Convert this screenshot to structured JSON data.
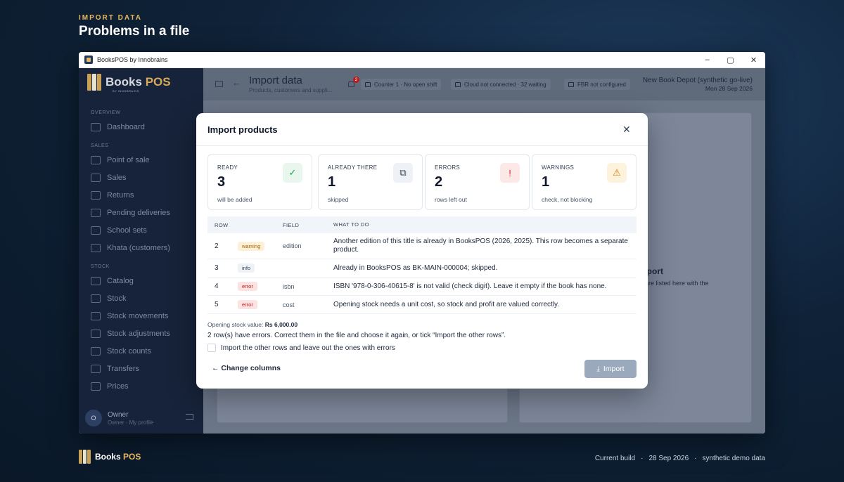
{
  "hero": {
    "eyebrow": "IMPORT DATA",
    "title": "Problems in a file"
  },
  "window": {
    "title": "BooksPOS by Innobrains",
    "controls": [
      "–",
      "▢",
      "✕"
    ]
  },
  "sidebar": {
    "logo": {
      "name_a": "Books",
      "name_b": "POS",
      "sub": "BY INNOBRAINS"
    },
    "sections": {
      "overview": "OVERVIEW",
      "sales": "SALES",
      "stock": "STOCK"
    },
    "items": {
      "dashboard": "Dashboard",
      "pos": "Point of sale",
      "sales": "Sales",
      "returns": "Returns",
      "pending": "Pending deliveries",
      "school": "School sets",
      "khata": "Khata (customers)",
      "catalog": "Catalog",
      "stock": "Stock",
      "movements": "Stock movements",
      "adjustments": "Stock adjustments",
      "counts": "Stock counts",
      "transfers": "Transfers",
      "prices": "Prices"
    },
    "user": {
      "initial": "O",
      "name": "Owner",
      "sub": "Owner · My profile"
    }
  },
  "topbar": {
    "title": "Import data",
    "subtitle": "Products, customers and suppli...",
    "notif_count": "2",
    "counter": "Counter 1 · No open shift",
    "cloud": "Cloud not connected · 32 waiting",
    "fbr": "FBR not configured",
    "store": "New Book Depot (synthetic go-live)",
    "date": "Mon 28 Sep 2026"
  },
  "background": {
    "title_fragment": "mport",
    "text_fragment": "ut are listed here with the"
  },
  "modal": {
    "title": "Import products",
    "close": "✕",
    "stats": [
      {
        "label": "READY",
        "value": "3",
        "sub": "will be added",
        "icon": "✓",
        "icon_name": "check-circle-icon",
        "color": "#16a34a",
        "bg": "#e8f6ee"
      },
      {
        "label": "ALREADY THERE",
        "value": "1",
        "sub": "skipped",
        "icon": "⧉",
        "icon_name": "copy-icon",
        "color": "#334155",
        "bg": "#eef2f6"
      },
      {
        "label": "ERRORS",
        "value": "2",
        "sub": "rows left out",
        "icon": "!",
        "icon_name": "alert-circle-icon",
        "color": "#dc2626",
        "bg": "#fde8e8"
      },
      {
        "label": "WARNINGS",
        "value": "1",
        "sub": "check, not blocking",
        "icon": "⚠",
        "icon_name": "warning-triangle-icon",
        "color": "#d97706",
        "bg": "#fdf3dc"
      }
    ],
    "table": {
      "headers": {
        "row": "ROW",
        "field": "FIELD",
        "what": "WHAT TO DO"
      },
      "rows": [
        {
          "row": "2",
          "tag": "warning",
          "field": "edition",
          "what": "Another edition of this title is already in BooksPOS (2026, 2025). This row becomes a separate product."
        },
        {
          "row": "3",
          "tag": "info",
          "field": "",
          "what": "Already in BooksPOS as BK-MAIN-000004; skipped."
        },
        {
          "row": "4",
          "tag": "error",
          "field": "isbn",
          "what": "ISBN '978-0-306-40615-8' is not valid (check digit). Leave it empty if the book has none."
        },
        {
          "row": "5",
          "tag": "error",
          "field": "cost",
          "what": "Opening stock needs a unit cost, so stock and profit are valued correctly."
        }
      ]
    },
    "opening_label": "Opening stock value:",
    "opening_value": "Rs 6,000.00",
    "errors_note": "2 row(s) have errors. Correct them in the file and choose it again, or tick “Import the other rows”.",
    "checkbox_label": "Import the other rows and leave out the ones with errors",
    "change_columns": "Change columns",
    "import_button": "Import"
  },
  "footer": {
    "logo_a": "Books",
    "logo_b": "POS",
    "build": "Current build",
    "sep": "·",
    "date": "28 Sep 2026",
    "data": "synthetic demo data"
  }
}
